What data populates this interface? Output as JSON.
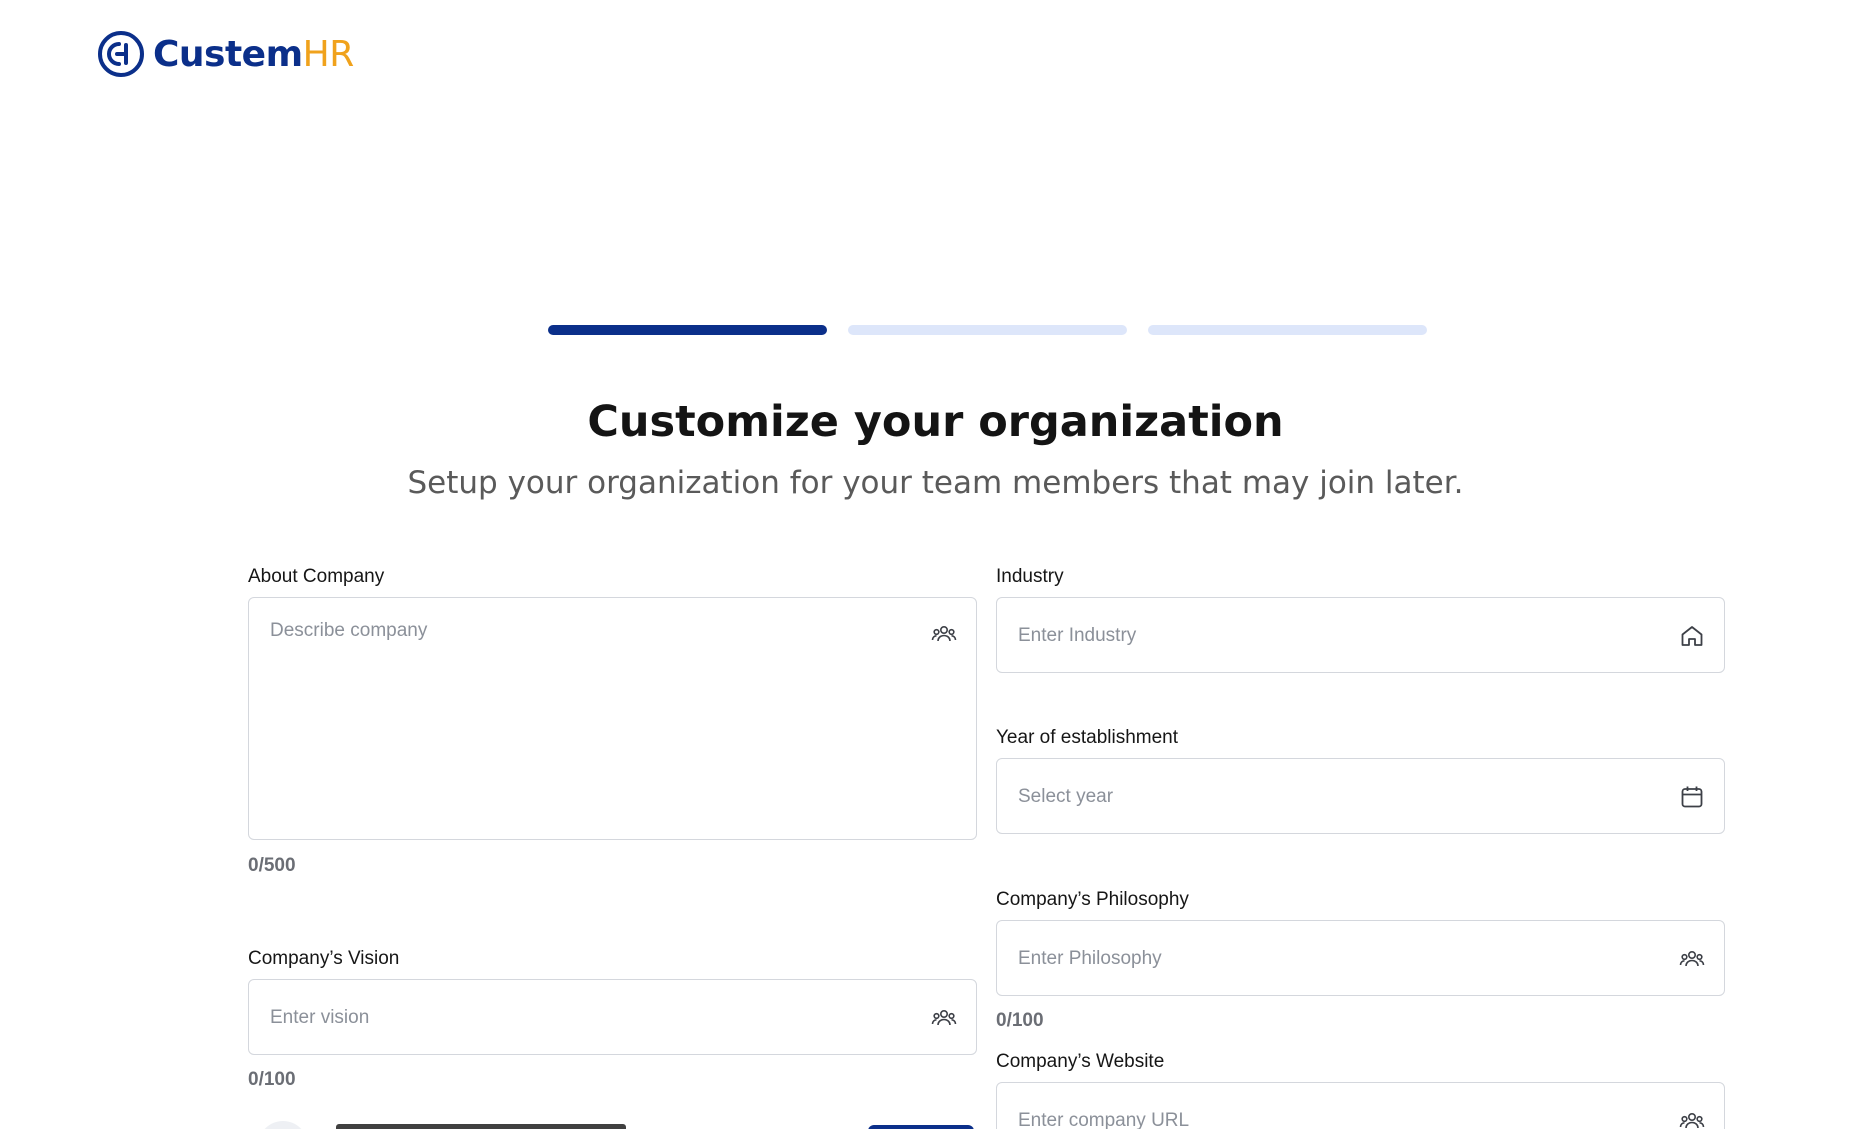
{
  "brand": {
    "name_part1": "Custem",
    "name_part2": "HR"
  },
  "progress": {
    "steps": 3,
    "current": 1
  },
  "header": {
    "title": "Customize your organization",
    "subtitle": "Setup your organization for your team members that may join later."
  },
  "fields": {
    "about": {
      "label": "About Company",
      "placeholder": "Describe company",
      "icon": "people-group-icon",
      "counter": "0/500"
    },
    "vision": {
      "label": "Company’s Vision",
      "placeholder": "Enter vision",
      "icon": "people-group-icon",
      "counter": "0/100"
    },
    "industry": {
      "label": "Industry",
      "placeholder": "Enter Industry",
      "icon": "house-icon"
    },
    "year": {
      "label": "Year of establishment",
      "placeholder": "Select year",
      "icon": "calendar-icon"
    },
    "philosophy": {
      "label": "Company’s Philosophy",
      "placeholder": "Enter Philosophy",
      "icon": "people-group-icon",
      "counter": "0/100"
    },
    "website": {
      "label": "Company’s Website",
      "placeholder": "Enter company URL",
      "icon": "people-group-icon"
    }
  },
  "colors": {
    "brand_primary": "#0b2f8a",
    "brand_accent": "#f0a21c",
    "progress_inactive": "#dde6fa"
  }
}
